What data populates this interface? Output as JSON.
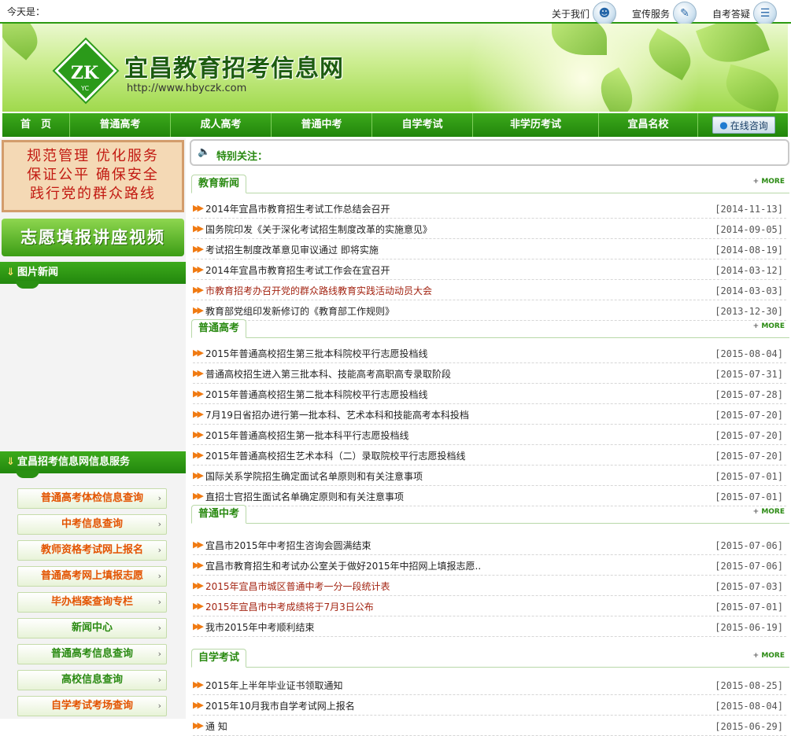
{
  "top": {
    "today_label": "今天是：",
    "links": [
      {
        "label": "关于我们",
        "icon": "person-icon"
      },
      {
        "label": "宣传服务",
        "icon": "document-icon"
      },
      {
        "label": "自考答疑",
        "icon": "folder-icon"
      }
    ]
  },
  "banner": {
    "logo_letters": "ZK",
    "logo_sub": "YC",
    "title": "宜昌教育招考信息网",
    "url": "http://www.hbyczk.com"
  },
  "nav": {
    "items": [
      "首　页",
      "普通高考",
      "成人高考",
      "普通中考",
      "自学考试",
      "非学历考试",
      "宜昌名校"
    ],
    "consult_label": "在线咨询"
  },
  "sidebar": {
    "slogan": [
      "规范管理  优化服务",
      "保证公平  确保安全",
      "践行党的群众路线"
    ],
    "video_label": "志愿填报讲座视频",
    "photo_news_label": "图片新闻",
    "service_label": "宜昌招考信息网信息服务",
    "services": [
      {
        "label": "普通高考体检信息查询"
      },
      {
        "label": "中考信息查询"
      },
      {
        "label": "教师资格考试网上报名"
      },
      {
        "label": "普通高考网上填报志愿"
      },
      {
        "label": "毕办档案查询专栏"
      },
      {
        "label": "新闻中心"
      },
      {
        "label": "普通高考信息查询"
      },
      {
        "label": "高校信息查询"
      },
      {
        "label": "自学考试考场查询"
      }
    ],
    "colors": {
      "orange": "#e35300",
      "green": "#2a8a12"
    }
  },
  "main": {
    "notice_label": "特别关注：",
    "more_label": "MORE",
    "sections": [
      {
        "title": "教育新闻",
        "items": [
          {
            "title": "2014年宜昌市教育招生考试工作总结会召开",
            "date": "[2014-11-13]",
            "highlight": false
          },
          {
            "title": "国务院印发《关于深化考试招生制度改革的实施意见》",
            "date": "[2014-09-05]",
            "highlight": false
          },
          {
            "title": "考试招生制度改革意见审议通过 即将实施",
            "date": "[2014-08-19]",
            "highlight": false
          },
          {
            "title": "2014年宜昌市教育招生考试工作会在宜召开",
            "date": "[2014-03-12]",
            "highlight": false
          },
          {
            "title": "市教育招考办召开党的群众路线教育实践活动动员大会",
            "date": "[2014-03-03]",
            "highlight": true
          },
          {
            "title": "教育部党组印发新修订的《教育部工作规则》",
            "date": "[2013-12-30]",
            "highlight": false
          }
        ]
      },
      {
        "title": "普通高考",
        "items": [
          {
            "title": "2015年普通高校招生第三批本科院校平行志愿投档线",
            "date": "[2015-08-04]",
            "highlight": false
          },
          {
            "title": "普通高校招生进入第三批本科、技能高考高职高专录取阶段",
            "date": "[2015-07-31]",
            "highlight": false
          },
          {
            "title": "2015年普通高校招生第二批本科院校平行志愿投档线",
            "date": "[2015-07-28]",
            "highlight": false
          },
          {
            "title": "7月19日省招办进行第一批本科、艺术本科和技能高考本科投档",
            "date": "[2015-07-20]",
            "highlight": false
          },
          {
            "title": "2015年普通高校招生第一批本科平行志愿投档线",
            "date": "[2015-07-20]",
            "highlight": false
          },
          {
            "title": "2015年普通高校招生艺术本科（二）录取院校平行志愿投档线",
            "date": "[2015-07-20]",
            "highlight": false
          },
          {
            "title": "国际关系学院招生确定面试名单原则和有关注意事项",
            "date": "[2015-07-01]",
            "highlight": false
          },
          {
            "title": "直招士官招生面试名单确定原则和有关注意事项",
            "date": "[2015-07-01]",
            "highlight": false
          }
        ]
      },
      {
        "title": "普通中考",
        "items": [
          {
            "title": "宜昌市2015年中考招生咨询会圆满结束",
            "date": "[2015-07-06]",
            "highlight": false
          },
          {
            "title": "宜昌市教育招生和考试办公室关于做好2015年中招网上填报志愿..",
            "date": "[2015-07-06]",
            "highlight": false
          },
          {
            "title": "2015年宜昌市城区普通中考一分一段统计表",
            "date": "[2015-07-03]",
            "highlight": true
          },
          {
            "title": "2015年宜昌市中考成绩将于7月3日公布",
            "date": "[2015-07-01]",
            "highlight": true
          },
          {
            "title": "我市2015年中考顺利结束",
            "date": "[2015-06-19]",
            "highlight": false
          }
        ]
      },
      {
        "title": "自学考试",
        "items": [
          {
            "title": "2015年上半年毕业证书领取通知",
            "date": "[2015-08-25]",
            "highlight": false
          },
          {
            "title": "2015年10月我市自学考试网上报名",
            "date": "[2015-08-04]",
            "highlight": false
          },
          {
            "title": "通 知",
            "date": "[2015-06-29]",
            "highlight": false
          }
        ]
      }
    ]
  }
}
